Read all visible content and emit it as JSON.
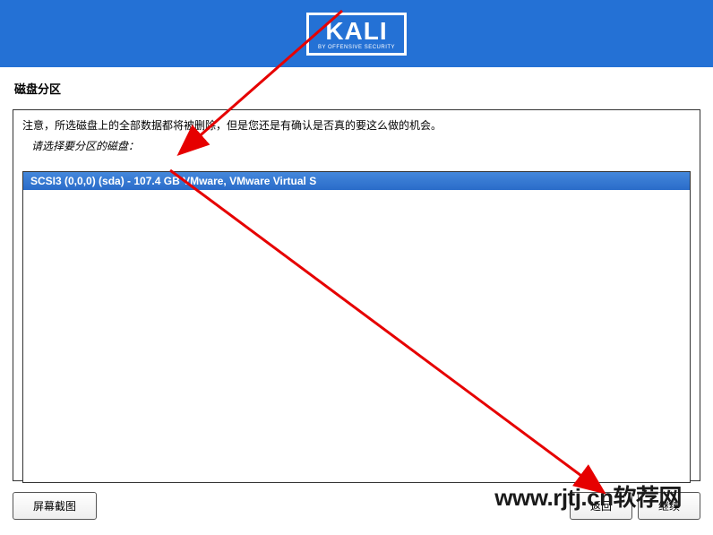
{
  "logo": {
    "main": "KALI",
    "sub": "BY OFFENSIVE SECURITY"
  },
  "title": "磁盘分区",
  "instruction": "注意，所选磁盘上的全部数据都将被删除，但是您还是有确认是否真的要这么做的机会。",
  "sub_instruction": "请选择要分区的磁盘：",
  "disk_item": "SCSI3 (0,0,0) (sda) - 107.4 GB VMware, VMware Virtual S",
  "buttons": {
    "screenshot": "屏幕截图",
    "back": "返回",
    "continue": "继续"
  },
  "watermark": "www.rjtj.cn软荐网"
}
